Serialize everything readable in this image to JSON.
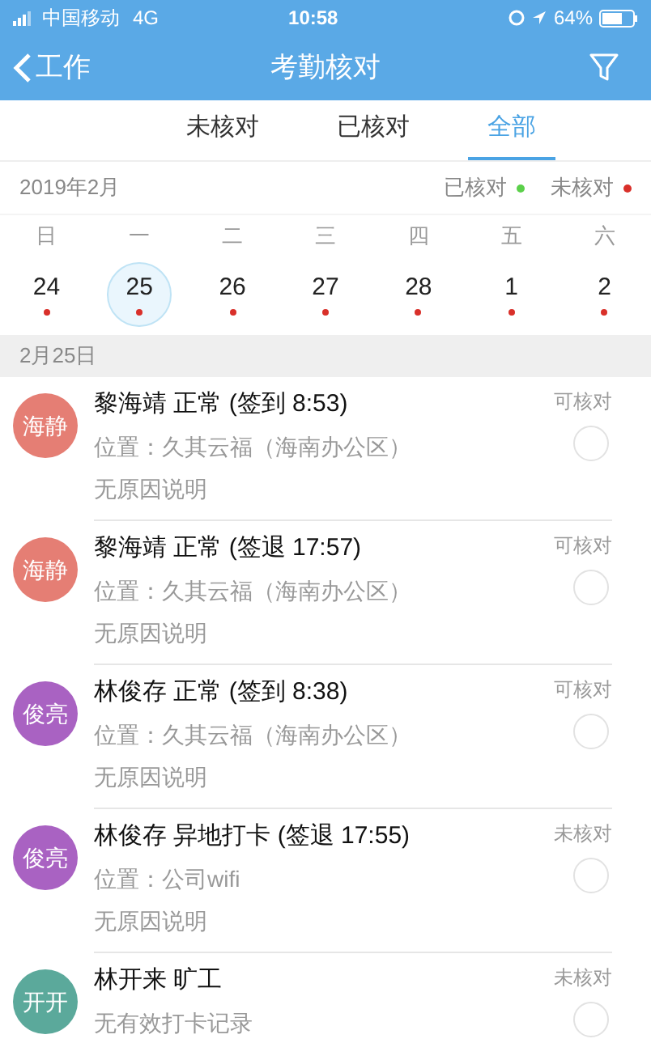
{
  "status_bar": {
    "carrier": "中国移动",
    "network": "4G",
    "time": "10:58",
    "battery": "64%"
  },
  "nav": {
    "back": "工作",
    "title": "考勤核对"
  },
  "tabs": [
    {
      "label": "未核对",
      "selected": false
    },
    {
      "label": "已核对",
      "selected": false
    },
    {
      "label": "全部",
      "selected": true
    }
  ],
  "calendar": {
    "month": "2019年2月",
    "legend": [
      {
        "label": "已核对",
        "color": "#5bd04a"
      },
      {
        "label": "未核对",
        "color": "#d9302a"
      }
    ],
    "weekdays": [
      "日",
      "一",
      "二",
      "三",
      "四",
      "五",
      "六"
    ],
    "days": [
      {
        "day": "24",
        "selected": false,
        "color": "#d9302a"
      },
      {
        "day": "25",
        "selected": true,
        "color": "#d9302a"
      },
      {
        "day": "26",
        "selected": false,
        "color": "#d9302a"
      },
      {
        "day": "27",
        "selected": false,
        "color": "#d9302a"
      },
      {
        "day": "28",
        "selected": false,
        "color": "#d9302a"
      },
      {
        "day": "1",
        "selected": false,
        "color": "#d9302a"
      },
      {
        "day": "2",
        "selected": false,
        "color": "#d9302a"
      }
    ]
  },
  "date_header": "2月25日",
  "records": [
    {
      "avatar": "海静",
      "color": "#e57e74",
      "title": "黎海靖 正常 (签到 8:53)",
      "lines": [
        "位置：久其云福（海南办公区）",
        "无原因说明"
      ],
      "status": "可核对",
      "checked": false
    },
    {
      "avatar": "海静",
      "color": "#e57e74",
      "title": "黎海靖 正常 (签退 17:57)",
      "lines": [
        "位置：久其云福（海南办公区）",
        "无原因说明"
      ],
      "status": "可核对",
      "checked": false
    },
    {
      "avatar": "俊亮",
      "color": "#a962c2",
      "title": "林俊存 正常 (签到 8:38)",
      "lines": [
        "位置：久其云福（海南办公区）",
        "无原因说明"
      ],
      "status": "可核对",
      "checked": false
    },
    {
      "avatar": "俊亮",
      "color": "#a962c2",
      "title": "林俊存 异地打卡 (签退 17:55)",
      "lines": [
        "位置：公司wifi",
        "无原因说明"
      ],
      "status": "未核对",
      "checked": false
    },
    {
      "avatar": "开开",
      "color": "#5ba99b",
      "title": "林开来 旷工",
      "lines": [
        "无有效打卡记录"
      ],
      "status": "未核对",
      "checked": false
    }
  ]
}
